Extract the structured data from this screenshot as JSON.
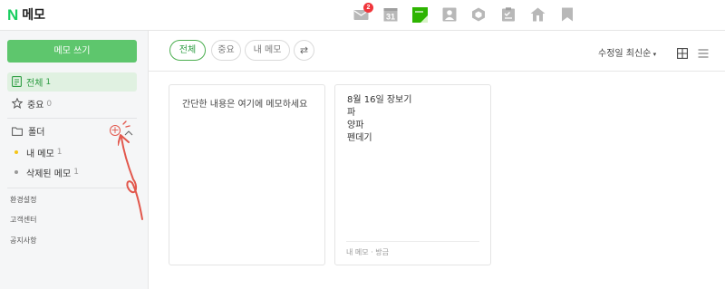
{
  "header": {
    "logo_letter": "N",
    "title": "메모",
    "apps": [
      {
        "name": "mail",
        "badge": "2"
      },
      {
        "name": "calendar",
        "label": "31"
      },
      {
        "name": "memo"
      },
      {
        "name": "contacts"
      },
      {
        "name": "mybox"
      },
      {
        "name": "todo"
      },
      {
        "name": "home"
      },
      {
        "name": "bookmark"
      }
    ]
  },
  "sidebar": {
    "write_button": "메모 쓰기",
    "all": {
      "label": "전체",
      "count": "1"
    },
    "favorites": {
      "label": "중요",
      "count": "0"
    },
    "folder_header": "폴더",
    "folders": [
      {
        "label": "내 메모",
        "count": "1",
        "dot_color": "#f5c518"
      },
      {
        "label": "삭제된 메모",
        "count": "1",
        "dot_color": "#999999"
      }
    ],
    "links": [
      "환경설정",
      "고객센터",
      "공지사항"
    ]
  },
  "toolbar": {
    "filters": [
      "전체",
      "중요",
      "내 메모"
    ],
    "swap_symbol": "⇄",
    "sort_label": "수정일 최신순"
  },
  "cards": [
    {
      "placeholder": "간단한 내용은 여기에 메모하세요"
    },
    {
      "lines": [
        "8월 16일 장보기",
        "파",
        "양파",
        "펜데기"
      ],
      "footer": "내 메모 · 방금"
    }
  ],
  "colors": {
    "brand_green": "#19ce60",
    "button_green": "#5ec66d",
    "annotation_red": "#e2574c",
    "badge_red": "#f0353b"
  }
}
